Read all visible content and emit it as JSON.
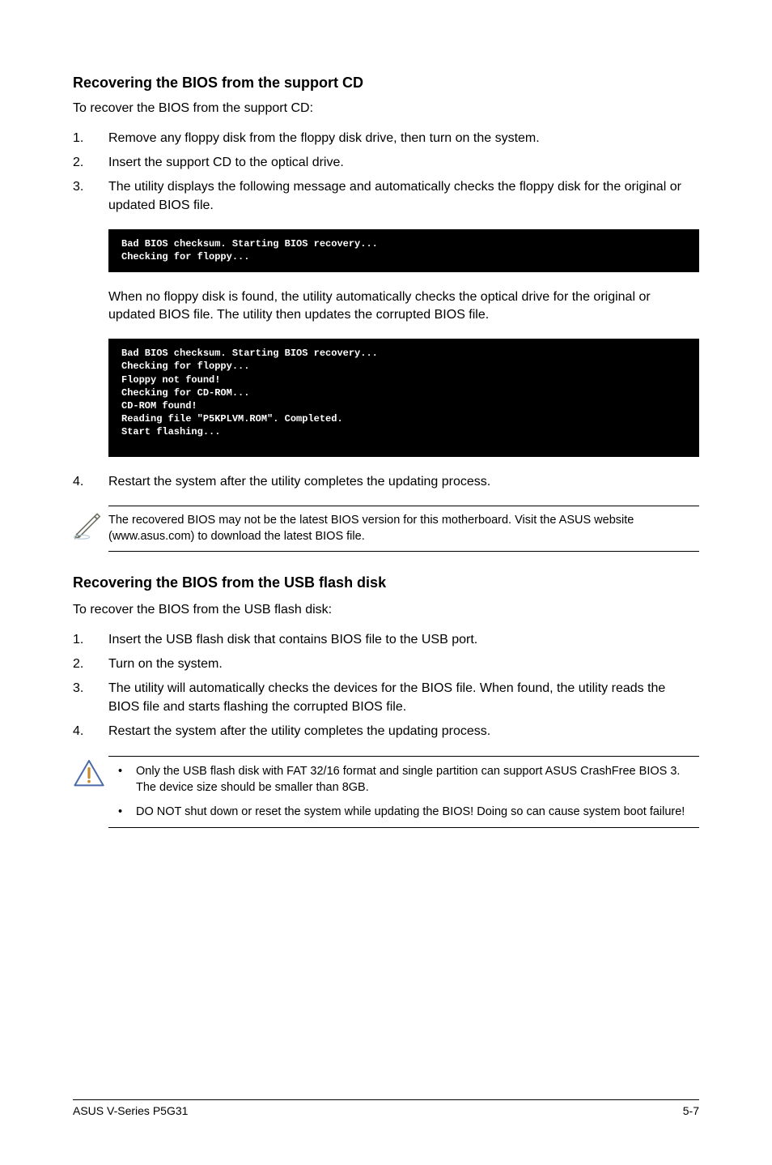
{
  "section1": {
    "heading": "Recovering the BIOS from the support CD",
    "intro": "To recover the BIOS from the support CD:",
    "steps": {
      "s1": {
        "num": "1.",
        "text": "Remove any floppy disk from the floppy disk drive, then turn on the system."
      },
      "s2": {
        "num": "2.",
        "text": "Insert the support CD to the optical drive."
      },
      "s3": {
        "num": "3.",
        "text": "The utility displays the following message and automatically checks the floppy disk for the original or updated BIOS file."
      }
    },
    "code1": "Bad BIOS checksum. Starting BIOS recovery...\nChecking for floppy...",
    "mid_para": "When no floppy disk is found, the utility automatically checks the optical drive for the original or updated BIOS file. The utility then updates the corrupted BIOS file.",
    "code2": "Bad BIOS checksum. Starting BIOS recovery...\nChecking for floppy...\nFloppy not found!\nChecking for CD-ROM...\nCD-ROM found!\nReading file \"P5KPLVM.ROM\". Completed.\nStart flashing...",
    "step4": {
      "num": "4.",
      "text": "Restart the system after the utility completes the updating process."
    },
    "note": "The recovered BIOS may not be the latest BIOS version for this motherboard. Visit the ASUS website (www.asus.com) to download the latest BIOS file."
  },
  "section2": {
    "heading": "Recovering the BIOS from the USB flash disk",
    "intro": "To recover the BIOS from the USB flash disk:",
    "steps": {
      "s1": {
        "num": "1.",
        "text": "Insert the USB flash disk that contains BIOS file to the USB port."
      },
      "s2": {
        "num": "2.",
        "text": "Turn on the system."
      },
      "s3": {
        "num": "3.",
        "text": "The utility will automatically checks the devices for the BIOS file. When found, the utility reads the BIOS file and starts flashing the corrupted BIOS file."
      },
      "s4": {
        "num": "4.",
        "text": "Restart the system after the utility completes the updating process."
      }
    },
    "warnings": {
      "w1": "Only the USB flash disk with FAT 32/16 format and single partition can support ASUS CrashFree BIOS 3. The device size should be smaller than 8GB.",
      "w2": "DO NOT shut down or reset the system while updating the BIOS! Doing so can cause system boot failure!"
    }
  },
  "footer": {
    "left": "ASUS  V-Series P5G31",
    "right": "5-7"
  },
  "bullets": {
    "dot": "•"
  }
}
